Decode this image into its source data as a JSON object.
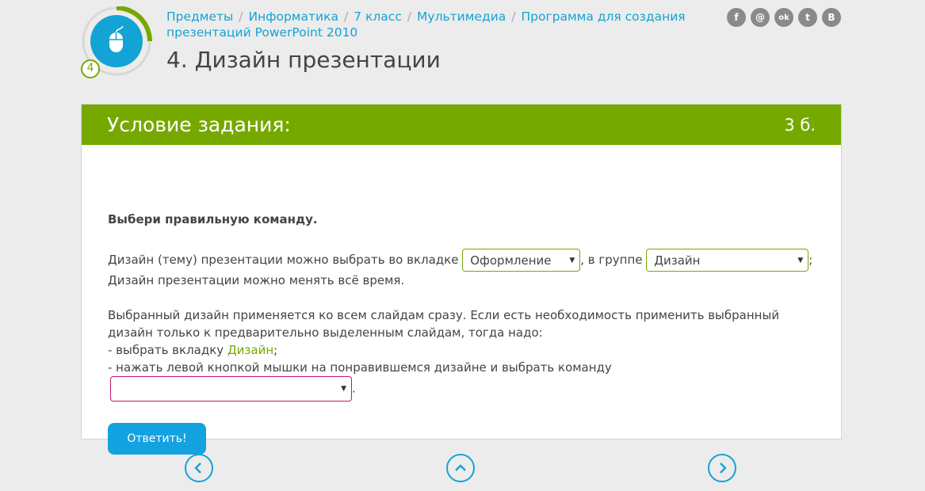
{
  "header": {
    "level_badge": "4",
    "breadcrumb": [
      "Предметы",
      "Информатика",
      "7 класс",
      "Мультимедиа",
      "Программа для создания презентаций PowerPoint 2010"
    ],
    "breadcrumb_separator": "/",
    "title": "4. Дизайн презентации",
    "social": [
      {
        "icon": "facebook-icon",
        "glyph": "f"
      },
      {
        "icon": "mail-icon",
        "glyph": "@"
      },
      {
        "icon": "odnoklassniki-icon",
        "glyph": "ok"
      },
      {
        "icon": "twitter-icon",
        "glyph": "t"
      },
      {
        "icon": "vkontakte-icon",
        "glyph": "B"
      }
    ]
  },
  "task": {
    "title": "Условие задания:",
    "points": "3 б.",
    "instruction": "Выбери правильную команду.",
    "p1_text1": "Дизайн (тему) презентации можно выбрать во вкладке",
    "p1_select_tab": "Оформление",
    "p1_text2": ", в группе",
    "p1_select_group": "Дизайн",
    "p1_text3": ";",
    "p1_text4": "Дизайн презентации можно менять всё время.",
    "p2_text1": "Выбранный дизайн применяется ко всем слайдам сразу. Если есть необходимость применить выбранный дизайн только к предварительно выделенным слайдам, тогда надо:",
    "p2_text2": "- выбрать вкладку",
    "p2_link": "Дизайн",
    "p2_text3": ";",
    "p2_text4": "- нажать левой кнопкой мышки на понравившемся дизайне и выбрать команду",
    "p2_select_command": "",
    "p2_text5": ".",
    "submit_label": "Ответить!"
  },
  "colors": {
    "accent_green": "#76a900",
    "accent_blue": "#13a3d4",
    "select_error": "#c0166b"
  }
}
